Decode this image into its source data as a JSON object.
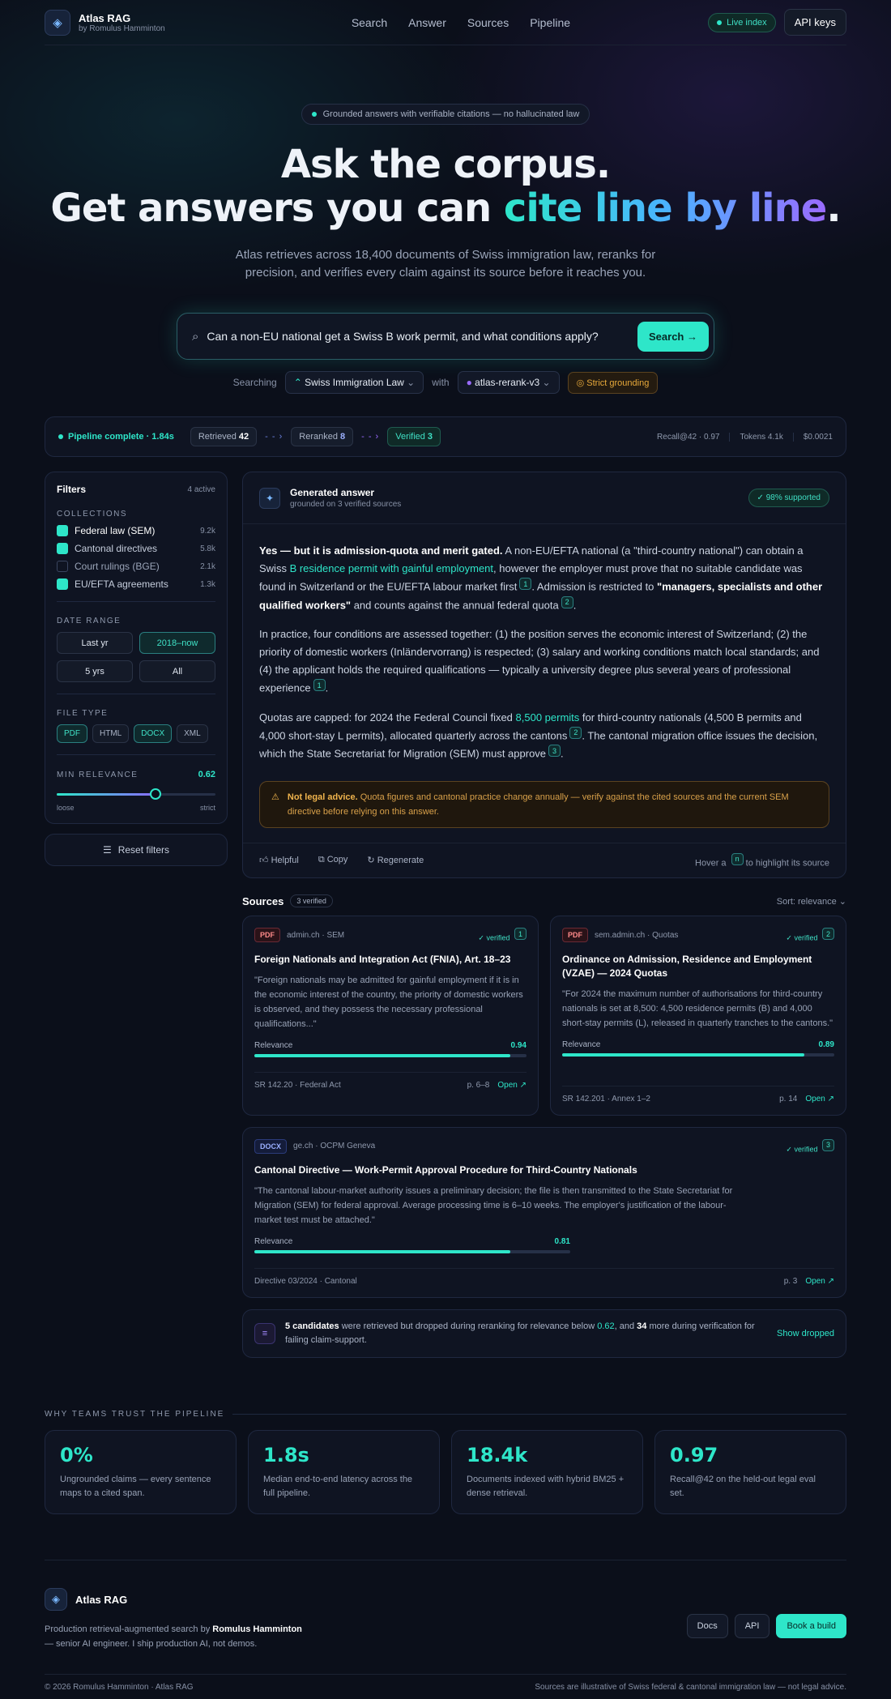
{
  "brand": {
    "name": "Atlas RAG",
    "sub": "by Romulus Hamminton",
    "icon": "layers-icon"
  },
  "nav": {
    "links": [
      "Search",
      "Answer",
      "Sources",
      "Pipeline"
    ],
    "live": "Live index",
    "api": "API keys"
  },
  "hero": {
    "tag": "Grounded answers with verifiable citations — no hallucinated law",
    "title1": "Ask the corpus.",
    "title2a": "Get answers you can ",
    "title2b": "cite line by line",
    "title2c": ".",
    "lead": "Atlas retrieves across 18,400 documents of Swiss immigration law, reranks for precision, and verifies every claim against its source before it reaches you."
  },
  "search": {
    "query": "Can a non-EU national get a Swiss B work permit, and what conditions apply?",
    "button": "Search",
    "searching": "Searching",
    "collection": "Swiss Immigration Law",
    "with": "with",
    "model": "atlas-rerank-v3",
    "grounding": "Strict grounding"
  },
  "pipeline": {
    "status": "Pipeline complete · 1.84s",
    "stages": [
      {
        "label": "Retrieved",
        "count": "42"
      },
      {
        "label": "Reranked",
        "count": "8"
      },
      {
        "label": "Verified",
        "count": "3"
      }
    ],
    "metrics": [
      "Recall@42 · 0.97",
      "Tokens 4.1k",
      "$0.0021"
    ]
  },
  "filters": {
    "title": "Filters",
    "active": "4 active",
    "collections_label": "COLLECTIONS",
    "collections": [
      {
        "label": "Federal law (SEM)",
        "count": "9.2k",
        "checked": true
      },
      {
        "label": "Cantonal directives",
        "count": "5.8k",
        "checked": true
      },
      {
        "label": "Court rulings (BGE)",
        "count": "2.1k",
        "checked": false
      },
      {
        "label": "EU/EFTA agreements",
        "count": "1.3k",
        "checked": true
      }
    ],
    "date_label": "DATE RANGE",
    "dates": [
      {
        "label": "Last yr",
        "on": false
      },
      {
        "label": "2018–now",
        "on": true
      },
      {
        "label": "5 yrs",
        "on": false
      },
      {
        "label": "All",
        "on": false
      }
    ],
    "type_label": "FILE TYPE",
    "types": [
      {
        "label": "PDF",
        "on": true
      },
      {
        "label": "HTML",
        "on": false
      },
      {
        "label": "DOCX",
        "on": true
      },
      {
        "label": "XML",
        "on": false
      }
    ],
    "relevance_label": "MIN RELEVANCE",
    "relevance": "0.62",
    "relevance_value": 0.62,
    "loose": "loose",
    "strict": "strict",
    "reset": "Reset filters"
  },
  "answer": {
    "title": "Generated answer",
    "subtitle": "grounded on 3 verified sources",
    "supported": "98% supported",
    "warn_bold": "Not legal advice.",
    "warn_text": " Quota figures and cantonal practice change annually — verify against the cited sources and the current SEM directive before relying on this answer.",
    "actions": [
      "Helpful",
      "Copy",
      "Regenerate"
    ],
    "hint_a": "Hover a ",
    "hint_n": "n",
    "hint_b": " to highlight its source"
  },
  "sources": {
    "title": "Sources",
    "count": "3 verified",
    "sort": "Sort: relevance",
    "relevance_label": "Relevance",
    "verified": "verified",
    "open": "Open ↗",
    "items": [
      {
        "type": "PDF",
        "origin": "admin.ch · SEM",
        "num": "1",
        "title": "Foreign Nationals and Integration Act (FNIA), Art. 18–23",
        "quote": "\"Foreign nationals may be admitted for gainful employment if it is in the economic interest of the country, the priority of domestic workers is observed, and they possess the necessary professional qualifications...\"",
        "relevance": "0.94",
        "rel": 0.94,
        "ref": "SR 142.20 · Federal Act",
        "page": "p. 6–8"
      },
      {
        "type": "PDF",
        "origin": "sem.admin.ch · Quotas",
        "num": "2",
        "title": "Ordinance on Admission, Residence and Employment (VZAE) — 2024 Quotas",
        "quote": "\"For 2024 the maximum number of authorisations for third-country nationals is set at 8,500: 4,500 residence permits (B) and 4,000 short-stay permits (L), released in quarterly tranches to the cantons.\"",
        "relevance": "0.89",
        "rel": 0.89,
        "ref": "SR 142.201 · Annex 1–2",
        "page": "p. 14"
      },
      {
        "type": "DOCX",
        "origin": "ge.ch · OCPM Geneva",
        "num": "3",
        "title": "Cantonal Directive — Work-Permit Approval Procedure for Third-Country Nationals",
        "quote": "\"The cantonal labour-market authority issues a preliminary decision; the file is then transmitted to the State Secretariat for Migration (SEM) for federal approval. Average processing time is 6–10 weeks. The employer's justification of the labour-market test must be attached.\"",
        "relevance": "0.81",
        "rel": 0.81,
        "ref": "Directive 03/2024 · Cantonal",
        "page": "p. 3"
      }
    ]
  },
  "dropped": {
    "a": "5 candidates",
    "b": " were retrieved but dropped during reranking for relevance below ",
    "c": "0.62",
    "d": ", and ",
    "e": "34",
    "f": " more during verification for failing claim-support.",
    "link": "Show dropped"
  },
  "trust": {
    "title": "WHY TEAMS TRUST THE PIPELINE",
    "stats": [
      {
        "n": "0%",
        "d": "Ungrounded claims — every sentence maps to a cited span."
      },
      {
        "n": "1.8s",
        "d": "Median end-to-end latency across the full pipeline."
      },
      {
        "n": "18.4k",
        "d": "Documents indexed with hybrid BM25 + dense retrieval."
      },
      {
        "n": "0.97",
        "d": "Recall@42 on the held-out legal eval set."
      }
    ]
  },
  "footer": {
    "name": "Atlas RAG",
    "desc_a": "Production retrieval-augmented search by ",
    "desc_b": "Romulus Hamminton",
    "desc_c": " — senior AI engineer. I ship production AI, not demos.",
    "buttons": [
      "Docs",
      "API",
      "Book a build"
    ],
    "copyright": "© 2026 Romulus Hamminton · Atlas RAG",
    "disclaimer": "Sources are illustrative of Swiss federal & cantonal immigration law — not legal advice."
  },
  "colors": {
    "accent": "#2ee6c9",
    "violet": "#9a6bff",
    "bg": "#0b0f1a",
    "warn": "#e8a93a"
  }
}
